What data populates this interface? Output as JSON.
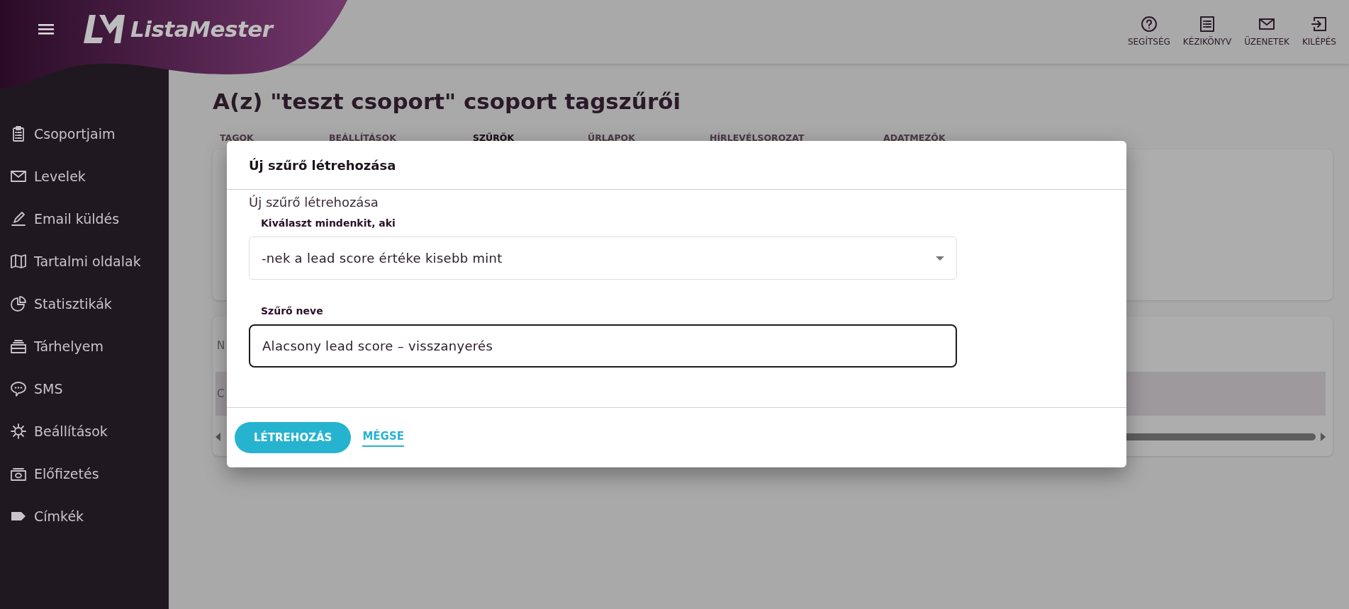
{
  "app": {
    "name": "ListaMester"
  },
  "header_links": [
    {
      "label": "SEGÍTSÉG"
    },
    {
      "label": "KÉZIKÖNYV"
    },
    {
      "label": "ÜZENETEK"
    },
    {
      "label": "KILÉPÉS"
    }
  ],
  "sidebar": {
    "items": [
      {
        "label": "Csoportjaim"
      },
      {
        "label": "Levelek"
      },
      {
        "label": "Email küldés"
      },
      {
        "label": "Tartalmi oldalak"
      },
      {
        "label": "Statisztikák"
      },
      {
        "label": "Tárhelyem"
      },
      {
        "label": "SMS"
      },
      {
        "label": "Beállítások"
      },
      {
        "label": "Előfizetés"
      },
      {
        "label": "Címkék"
      }
    ]
  },
  "page": {
    "title": "A(z) \"teszt csoport\" csoport tagszűrői",
    "tabs": [
      {
        "label": "TAGOK",
        "selected": false
      },
      {
        "label": "BEÁLLÍTÁSOK",
        "selected": false
      },
      {
        "label": "SZŰRŐK",
        "selected": true
      },
      {
        "label": "ŰRLAPOK",
        "selected": false
      },
      {
        "label": "HÍRLEVÉLSOROZAT",
        "selected": false
      },
      {
        "label": "ADATMEZŐK",
        "selected": false
      }
    ],
    "table": {
      "columns": [
        "N"
      ],
      "rows": [
        [
          "C"
        ]
      ]
    }
  },
  "modal": {
    "title": "Új szűrő létrehozása",
    "subtitle": "Új szűrő létrehozása",
    "fields": [
      {
        "kind": "select",
        "label": "Kiválaszt mindenkit, aki",
        "value": "-nek a lead score értéke kisebb mint",
        "focused": false
      },
      {
        "kind": "text",
        "label": "Szűrő neve",
        "value": "Alacsony lead score – visszanyerés",
        "focused": true
      }
    ],
    "buttons": [
      {
        "kind": "primary",
        "label": "LÉTREHOZÁS"
      },
      {
        "kind": "link",
        "label": "MÉGSE"
      }
    ]
  }
}
